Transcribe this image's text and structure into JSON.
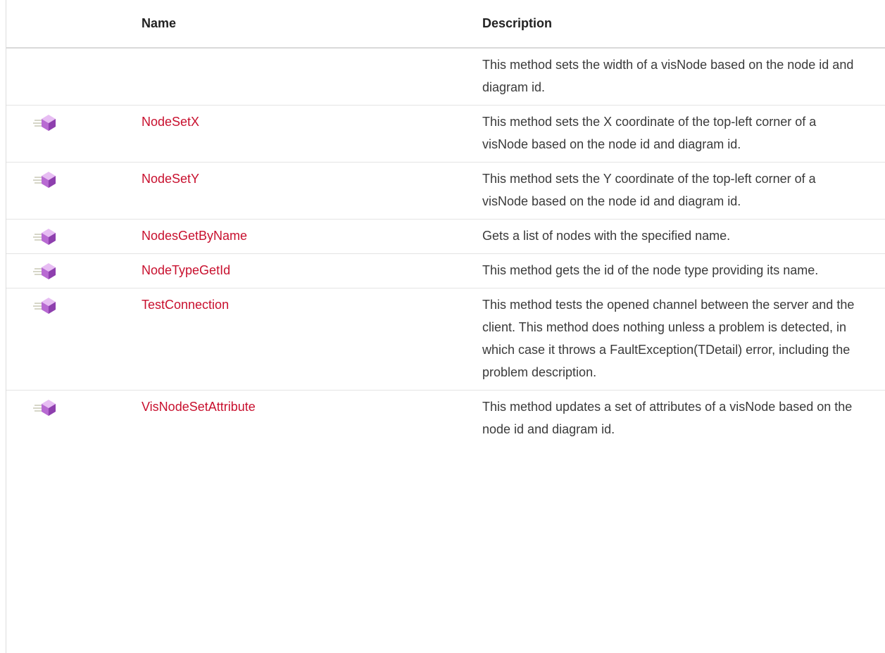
{
  "table": {
    "headers": {
      "icon": "",
      "name": "Name",
      "description": "Description"
    },
    "rows": [
      {
        "icon": "",
        "name": "",
        "description": "This method sets the width of a visNode based on the node id and diagram id."
      },
      {
        "icon": "public-method-icon",
        "name": "NodeSetX",
        "description": "This method sets the X coordinate of the top-left corner of a visNode based on the node id and diagram id."
      },
      {
        "icon": "public-method-icon",
        "name": "NodeSetY",
        "description": "This method sets the Y coordinate of the top-left corner of a visNode based on the node id and diagram id."
      },
      {
        "icon": "public-method-icon",
        "name": "NodesGetByName",
        "description": "Gets a list of nodes with the specified name."
      },
      {
        "icon": "public-method-icon",
        "name": "NodeTypeGetId",
        "description": "This method gets the id of the node type providing its name."
      },
      {
        "icon": "public-method-icon",
        "name": "TestConnection",
        "description": "This method tests the opened channel between the server and the client. This method does nothing unless a problem is detected, in which case it throws a FaultException(TDetail) error, including the problem description."
      },
      {
        "icon": "public-method-icon",
        "name": "VisNodeSetAttribute",
        "description": "This method updates a set of attributes of a visNode based on the node id and diagram id."
      }
    ]
  },
  "colors": {
    "link": "#c8102e",
    "text": "#333333",
    "rule": "#e4e4e4",
    "icon_purple": "#b86ad2"
  }
}
